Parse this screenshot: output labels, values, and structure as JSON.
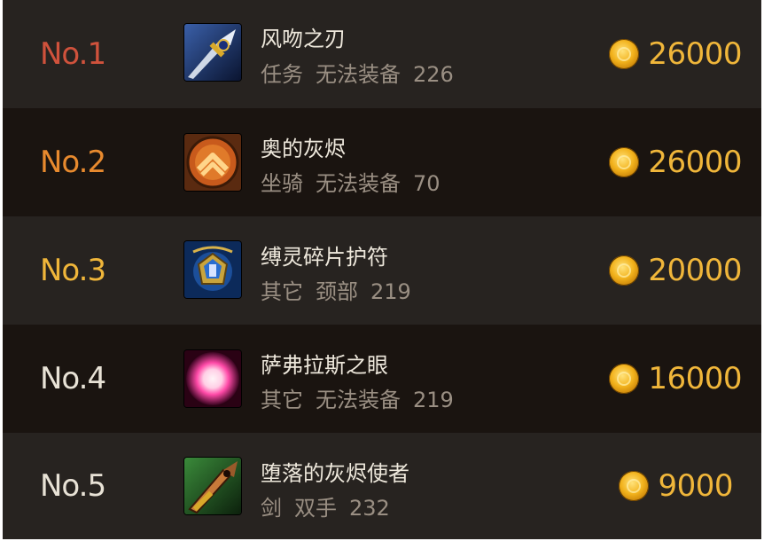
{
  "colors": {
    "rank1": "#d0523c",
    "rank2": "#e88a2e",
    "rank3": "#f0b63a",
    "rank4": "#e8e2d6",
    "rank5": "#e8e2d6",
    "price": "#f0b63a"
  },
  "items": [
    {
      "rank": "No.1",
      "name": "风吻之刃",
      "meta": [
        "任务",
        "无法装备",
        "226"
      ],
      "price": "26000",
      "icon": "sword-icon"
    },
    {
      "rank": "No.2",
      "name": "奥的灰烬",
      "meta": [
        "坐骑",
        "无法装备",
        "70"
      ],
      "price": "26000",
      "icon": "mount-emblem-icon"
    },
    {
      "rank": "No.3",
      "name": "缚灵碎片护符",
      "meta": [
        "其它",
        "颈部",
        "219"
      ],
      "price": "20000",
      "icon": "amulet-icon"
    },
    {
      "rank": "No.4",
      "name": "萨弗拉斯之眼",
      "meta": [
        "其它",
        "无法装备",
        "219"
      ],
      "price": "16000",
      "icon": "glowing-orb-icon"
    },
    {
      "rank": "No.5",
      "name": "堕落的灰烬使者",
      "meta": [
        "剑",
        "双手",
        "232"
      ],
      "price": "9000",
      "icon": "greatsword-icon"
    }
  ]
}
